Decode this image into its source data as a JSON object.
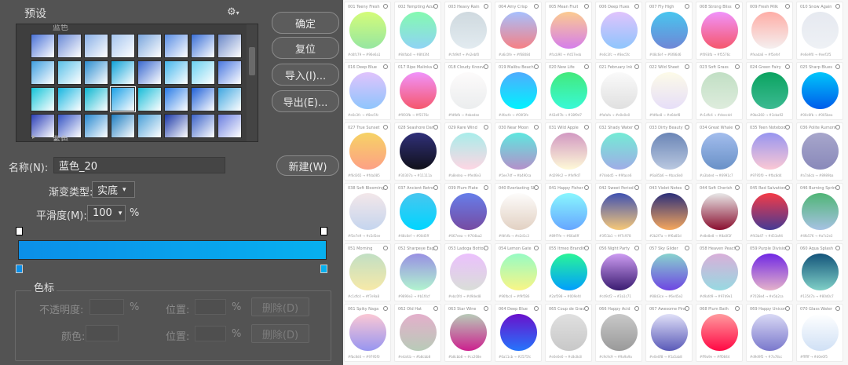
{
  "dialog": {
    "presets_label": "预设",
    "preset_partial_label": "蓝色",
    "preset_bottom_label": "紫色",
    "buttons": {
      "ok": "确定",
      "reset": "复位",
      "import": "导入(I)...",
      "export": "导出(E)...",
      "new": "新建(W)"
    },
    "name_label": "名称(N):",
    "name_value": "蓝色_20",
    "gradient_type_label": "渐变类型:",
    "gradient_type_value": "实底",
    "smoothness_label": "平滑度(M):",
    "smoothness_value": "100",
    "smoothness_unit": "%",
    "gradient_start_color": "#0b8fe8",
    "gradient_end_color": "#07b0ef",
    "color_stops_group": "色标",
    "opacity_label": "不透明度:",
    "location_label": "位置:",
    "percent": "%",
    "delete_label": "删除(D)",
    "color_label": "颜色:",
    "preset_swatches": [
      [
        "#4a72d6",
        "#6a8ad6",
        "#8ab0e6",
        "#a5c5ee",
        "#7aa6dd",
        "#5a8ee4",
        "#3a6fd6",
        "#6b88c8"
      ],
      [
        "#3fa0e0",
        "#5ac0e8",
        "#2d8ed0",
        "#0fa3d8",
        "#3b6ad0",
        "#45b6ec",
        "#6ad0f0",
        "#4a78e0"
      ],
      [
        "#14c4d8",
        "#18b6e0",
        "#0db6d0",
        "#1aa0e6",
        "#18bcd8",
        "#2a7ce6",
        "#1f60d8",
        "#3fa6e0"
      ],
      [
        "#2b3fb8",
        "#3553c4",
        "#2a8ad0",
        "#1f7ec2",
        "#4aa0d8",
        "#1d3aa8",
        "#3b62c8",
        "#6a7ee0"
      ]
    ]
  },
  "cards": [
    {
      "name": "001 Teeny Fresh",
      "c1": "#d4fc79",
      "c2": "#96e6a1",
      "h1": "#d4fc79",
      "h2": "#96e6a1"
    },
    {
      "name": "002 Tempting Azure",
      "c1": "#84fab0",
      "c2": "#8fd3f4",
      "h1": "#84fab0",
      "h2": "#8fd3f4"
    },
    {
      "name": "003 Heavy Rain",
      "c1": "#cfd9df",
      "c2": "#e2ebf0",
      "h1": "#cfd9df",
      "h2": "#e2ebf0"
    },
    {
      "name": "004 Amy Crisp",
      "c1": "#a6c0fe",
      "c2": "#f68084",
      "h1": "#a6c0fe",
      "h2": "#f68084"
    },
    {
      "name": "005 Mean Fruit",
      "c1": "#fccb90",
      "c2": "#d57eeb",
      "h1": "#fccb90",
      "h2": "#d57eeb"
    },
    {
      "name": "006 Deep Hues",
      "c1": "#e0c3fc",
      "c2": "#8ec5fc",
      "h1": "#e0c3fc",
      "h2": "#8ec5fc"
    },
    {
      "name": "007 Fly High",
      "c1": "#48c6ef",
      "c2": "#6f86d6",
      "h1": "#48c6ef",
      "h2": "#6f86d6"
    },
    {
      "name": "008 Strong Bliss",
      "c1": "#f093fb",
      "c2": "#f5576c",
      "h1": "#f093fb",
      "h2": "#f5576c"
    },
    {
      "name": "009 Fresh Milk",
      "c1": "#feada6",
      "c2": "#f5efef",
      "h1": "#feada6",
      "h2": "#f5efef"
    },
    {
      "name": "010 Snow Again",
      "c1": "#e6e9f0",
      "c2": "#eef1f5",
      "h1": "#e6e9f0",
      "h2": "#eef1f5"
    },
    {
      "name": "016 Deep Blue",
      "c1": "#e0c3fc",
      "c2": "#8ec5fc",
      "h1": "#e0c3fc",
      "h2": "#8ec5fc"
    },
    {
      "name": "017 Ripe Malinka",
      "c1": "#f093fb",
      "c2": "#f5576c",
      "h1": "#f093fb",
      "h2": "#f5576c"
    },
    {
      "name": "018 Cloudy Knoxville",
      "c1": "#fdfbfb",
      "c2": "#ebedee",
      "h1": "#fdfbfb",
      "h2": "#ebedee"
    },
    {
      "name": "019 Malibu Beach",
      "c1": "#4facfe",
      "c2": "#00f2fe",
      "h1": "#4facfe",
      "h2": "#00f2fe"
    },
    {
      "name": "020 New Life",
      "c1": "#43e97b",
      "c2": "#38f9d7",
      "h1": "#43e97b",
      "h2": "#38f9d7"
    },
    {
      "name": "021 February Ink",
      "c1": "#fafafa",
      "c2": "#e0e0e0",
      "h1": "#fafafa",
      "h2": "#e0e0e0"
    },
    {
      "name": "022 Wild Sheet",
      "c1": "#fdfbe8",
      "c2": "#e6def8",
      "h1": "#fdfbe8",
      "h2": "#e6def8"
    },
    {
      "name": "023 Soft Grass",
      "c1": "#c1dfc4",
      "c2": "#deecdd",
      "h1": "#c1dfc4",
      "h2": "#deecdd"
    },
    {
      "name": "024 Green Fairy",
      "c1": "#0ba360",
      "c2": "#3cba92",
      "h1": "#0ba360",
      "h2": "#3cba92"
    },
    {
      "name": "025 Sharp Blues",
      "c1": "#00c6fb",
      "c2": "#005bea",
      "h1": "#00c6fb",
      "h2": "#005bea"
    },
    {
      "name": "027 True Sunset",
      "c1": "#f6d365",
      "c2": "#fda085",
      "h1": "#f6d365",
      "h2": "#fda085"
    },
    {
      "name": "028 Seashore Dark",
      "c1": "#30307a",
      "c2": "#11111a",
      "h1": "#30307a",
      "h2": "#11111a"
    },
    {
      "name": "029 Rare Wind",
      "c1": "#a8edea",
      "c2": "#fed6e3",
      "h1": "#a8edea",
      "h2": "#fed6e3"
    },
    {
      "name": "030 Near Moon",
      "c1": "#5ee7df",
      "c2": "#b490ca",
      "h1": "#5ee7df",
      "h2": "#b490ca"
    },
    {
      "name": "031 Wild Apple",
      "c1": "#d299c2",
      "c2": "#fef9d7",
      "h1": "#d299c2",
      "h2": "#fef9d7"
    },
    {
      "name": "032 Shady Water",
      "c1": "#74ebd5",
      "c2": "#9face6",
      "h1": "#74ebd5",
      "h2": "#9face6"
    },
    {
      "name": "033 Dirty Beauty",
      "c1": "#6a85b6",
      "c2": "#bac8e0",
      "h1": "#6a85b6",
      "h2": "#bac8e0"
    },
    {
      "name": "034 Great Whale",
      "c1": "#a3bded",
      "c2": "#6991c7",
      "h1": "#a3bded",
      "h2": "#6991c7"
    },
    {
      "name": "035 Teen Notebook",
      "c1": "#9795f0",
      "c2": "#fbc8d4",
      "h1": "#9795f0",
      "h2": "#fbc8d4"
    },
    {
      "name": "036 Polite Rumors",
      "c1": "#a7a6cb",
      "c2": "#8989ba",
      "h1": "#a7a6cb",
      "h2": "#8989ba"
    },
    {
      "name": "038 Soft Blooming",
      "c1": "#f3e7e9",
      "c2": "#c5d5ee",
      "h1": "#f3e7e9",
      "h2": "#c5d5ee"
    },
    {
      "name": "037 Ancient Retro",
      "c1": "#48c6ef",
      "c2": "#00d5ff",
      "h1": "#48c6ef",
      "h2": "#00d5ff"
    },
    {
      "name": "039 Plum Plate",
      "c1": "#667eea",
      "c2": "#764ba2",
      "h1": "#667eea",
      "h2": "#764ba2"
    },
    {
      "name": "040 Everlasting Sky",
      "c1": "#fdfcfb",
      "c2": "#e2d1c3",
      "h1": "#fdfcfb",
      "h2": "#e2d1c3"
    },
    {
      "name": "041 Happy Fisher",
      "c1": "#89f7fe",
      "c2": "#66a6ff",
      "h1": "#89f7fe",
      "h2": "#66a6ff"
    },
    {
      "name": "042 Sweet Period",
      "c1": "#3f51b1",
      "c2": "#f7c978",
      "h1": "#3f51b1",
      "h2": "#f7c978"
    },
    {
      "name": "043 Violet Notes",
      "c1": "#2b2f7a",
      "c2": "#f6a85d",
      "h1": "#2b2f7a",
      "h2": "#f6a85d"
    },
    {
      "name": "044 Soft Cherish",
      "c1": "#e8e8e8",
      "c2": "#8a0f2f",
      "h1": "#e8e8e8",
      "h2": "#8a0f2f"
    },
    {
      "name": "045 Red Salvation",
      "c1": "#f43b47",
      "c2": "#453a94",
      "h1": "#f43b47",
      "h2": "#453a94"
    },
    {
      "name": "046 Burning Spring",
      "c1": "#4fb576",
      "c2": "#a7c2e3",
      "h1": "#4fb576",
      "h2": "#a7c2e3"
    },
    {
      "name": "051 Morning",
      "c1": "#c1dfc4",
      "c2": "#f7e9a8",
      "h1": "#c1dfc4",
      "h2": "#f7e9a8"
    },
    {
      "name": "052 Sharpeye Eagle",
      "c1": "#9890e3",
      "c2": "#b1f4cf",
      "h1": "#9890e3",
      "h2": "#b1f4cf"
    },
    {
      "name": "053 Ladoga Bottom",
      "c1": "#ebc0fd",
      "c2": "#d9ded8",
      "h1": "#ebc0fd",
      "h2": "#d9ded8"
    },
    {
      "name": "054 Lemon Gate",
      "c1": "#96fbc4",
      "c2": "#f9f586",
      "h1": "#96fbc4",
      "h2": "#f9f586"
    },
    {
      "name": "055 Itmeo Branding",
      "c1": "#2af598",
      "c2": "#009efd",
      "h1": "#2af598",
      "h2": "#009efd"
    },
    {
      "name": "056 Night Party",
      "c1": "#cd9cf2",
      "c2": "#3a1c71",
      "h1": "#cd9cf2",
      "h2": "#3a1c71"
    },
    {
      "name": "057 Sky Glider",
      "c1": "#88d3ce",
      "c2": "#6e45e2",
      "h1": "#88d3ce",
      "h2": "#6e45e2"
    },
    {
      "name": "058 Heaven Peach",
      "c1": "#d9afd9",
      "c2": "#97d9e1",
      "h1": "#d9afd9",
      "h2": "#97d9e1"
    },
    {
      "name": "059 Purple Division",
      "c1": "#7028e4",
      "c2": "#e5b2ca",
      "h1": "#7028e4",
      "h2": "#e5b2ca"
    },
    {
      "name": "060 Aqua Splash",
      "c1": "#13547a",
      "c2": "#80d0c7",
      "h1": "#13547a",
      "h2": "#80d0c7"
    },
    {
      "name": "061 Spiky Naga",
      "c1": "#fbc8d4",
      "c2": "#9795f0",
      "h1": "#fbc8d4",
      "h2": "#9795f0"
    },
    {
      "name": "062 Old Hat",
      "c1": "#e4afcb",
      "c2": "#b8cbb8",
      "h1": "#e4afcb",
      "h2": "#b8cbb8"
    },
    {
      "name": "063 Star Wine",
      "c1": "#b8cbb8",
      "c2": "#cc208e",
      "h1": "#b8cbb8",
      "h2": "#cc208e"
    },
    {
      "name": "064 Deep Blue",
      "c1": "#6a11cb",
      "c2": "#2575fc",
      "h1": "#6a11cb",
      "h2": "#2575fc"
    },
    {
      "name": "065 Coup de Grace",
      "c1": "#e0e0e0",
      "c2": "#c8c8c8",
      "h1": "#e0e0e0",
      "h2": "#c8c8c8"
    },
    {
      "name": "066 Happy Acid",
      "c1": "#c9c9c9",
      "c2": "#9a9a9a",
      "h1": "#c9c9c9",
      "h2": "#9a9a9a"
    },
    {
      "name": "067 Awesome Pine",
      "c1": "#e0e0f8",
      "c2": "#5a5ab8",
      "h1": "#e0e0f8",
      "h2": "#5a5ab8"
    },
    {
      "name": "068 Plum Bath",
      "c1": "#ff9a9e",
      "c2": "#ff0844",
      "h1": "#ff9a9e",
      "h2": "#ff0844"
    },
    {
      "name": "069 Happy Unicorn",
      "c1": "#d9d9f5",
      "c2": "#7a78cc",
      "h1": "#d9d9f5",
      "h2": "#7a78cc"
    },
    {
      "name": "070 Glass Water",
      "c1": "#ffffff",
      "c2": "#d0e0f5",
      "h1": "#ffffff",
      "h2": "#d0e0f5"
    }
  ]
}
